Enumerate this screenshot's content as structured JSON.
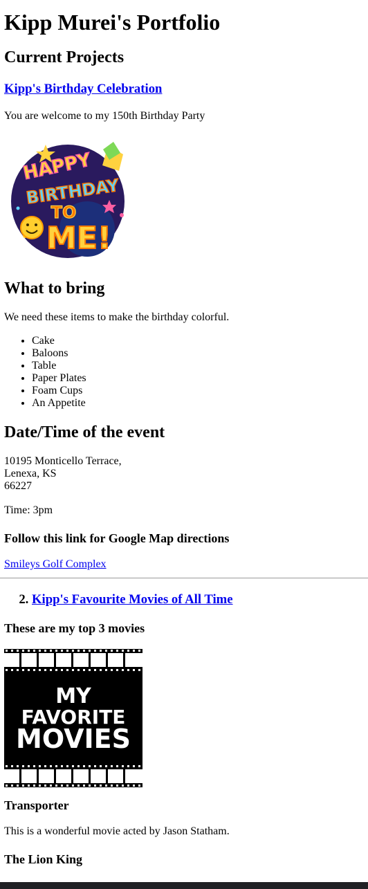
{
  "page": {
    "title": "Kipp Murei's Portfolio"
  },
  "current_projects": {
    "heading": "Current Projects",
    "project1": {
      "link_label": "Kipp's Birthday Celebration",
      "intro": "You are welcome to my 150th Birthday Party",
      "image_alt": "Happy Birthday to Me",
      "art_lines": [
        "HAPPY",
        "BIRTHDAY",
        "TO",
        "ME!"
      ]
    },
    "what_to_bring": {
      "heading": "What to bring",
      "intro": "We need these items to make the birthday colorful.",
      "items": [
        "Cake",
        "Baloons",
        "Table",
        "Paper Plates",
        "Foam Cups",
        "An Appetite"
      ]
    },
    "event": {
      "heading": "Date/Time of the event",
      "address_line1": "10195 Monticello Terrace,",
      "address_line2": "Lenexa, KS",
      "address_line3": "66227",
      "time": "Time: 3pm",
      "map_heading": "Follow this link for Google Map directions",
      "map_link": "Smileys Golf Complex"
    },
    "project2": {
      "number": "2.",
      "link_label": "Kipp's Favourite Movies of All Time",
      "subheading": "These are my top 3 movies",
      "image_art_lines": [
        "MY",
        "FAVORITE",
        "MOVIES"
      ],
      "movies": [
        {
          "title": "Transporter",
          "desc": "This is a wonderful movie acted by Jason Statham."
        },
        {
          "title": "The Lion King"
        }
      ]
    }
  },
  "colors": {
    "link": "#0000ee",
    "separator": "#9a9a9a",
    "bottom_bar": "#202124"
  }
}
